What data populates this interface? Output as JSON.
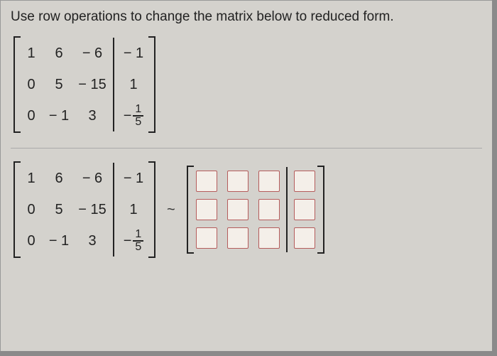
{
  "prompt": "Use row operations to change the matrix below to reduced form.",
  "chart_data": {
    "type": "table",
    "matrix_top": {
      "rows": [
        [
          "1",
          "6",
          "− 6",
          "− 1"
        ],
        [
          "0",
          "5",
          "− 15",
          "1"
        ],
        [
          "0",
          "− 1",
          "3",
          "− 1/5"
        ]
      ],
      "augment_after_col": 3
    },
    "matrix_bottom_left": {
      "rows": [
        [
          "1",
          "6",
          "− 6",
          "− 1"
        ],
        [
          "0",
          "5",
          "− 15",
          "1"
        ],
        [
          "0",
          "− 1",
          "3",
          "− 1/5"
        ]
      ],
      "augment_after_col": 3
    },
    "relation": "~",
    "matrix_bottom_right": {
      "rows": 3,
      "cols": 4,
      "augment_after_col": 3,
      "cells": "blank-input"
    }
  },
  "m": {
    "r0c0": "1",
    "r0c1": "6",
    "r0c2": "− 6",
    "r0c3": "− 1",
    "r1c0": "0",
    "r1c1": "5",
    "r1c2": "− 15",
    "r1c3": "1",
    "r2c0": "0",
    "r2c1": "− 1",
    "r2c2": "3",
    "frac_neg": "−",
    "frac_n": "1",
    "frac_d": "5"
  },
  "rel": "~"
}
